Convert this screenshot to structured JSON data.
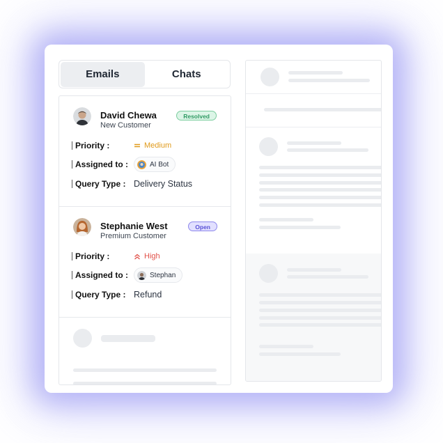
{
  "tabs": [
    {
      "label": "Emails",
      "active": true
    },
    {
      "label": "Chats",
      "active": false
    }
  ],
  "labels": {
    "priority": "Priority :",
    "assigned": "Assigned to :",
    "query": "Query Type :"
  },
  "tickets": [
    {
      "name": "David Chewa",
      "customer_type": "New Customer",
      "status": "Resolved",
      "priority": "Medium",
      "priority_icon": "equals-icon",
      "assignee": "AI Bot",
      "query_type": "Delivery Status"
    },
    {
      "name": "Stephanie West",
      "customer_type": "Premium Customer",
      "status": "Open",
      "priority": "High",
      "priority_icon": "double-chevron-up-icon",
      "assignee": "Stephan",
      "query_type": "Refund"
    }
  ],
  "colors": {
    "accent_glow": "#8e8cf0",
    "resolved": "#2f9a63",
    "open": "#5a52d6",
    "medium": "#e09a1a",
    "high": "#e1524a"
  }
}
